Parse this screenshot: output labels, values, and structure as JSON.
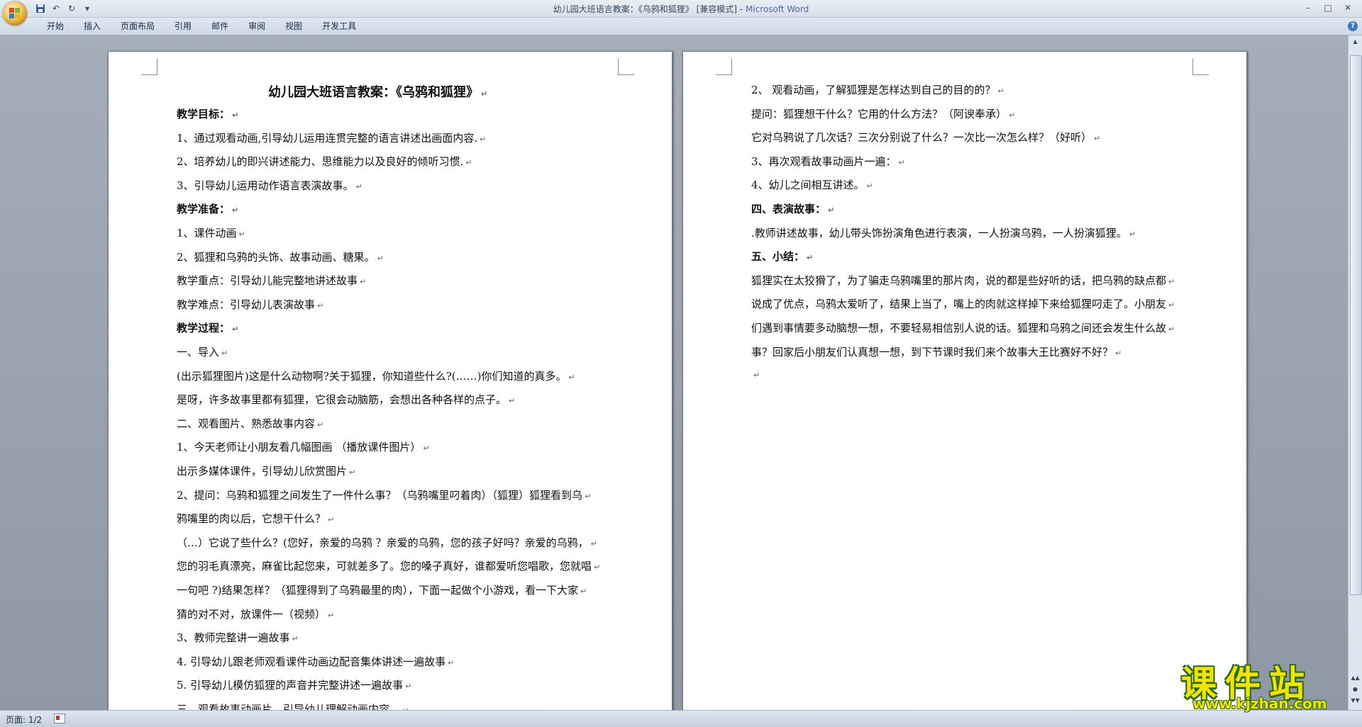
{
  "window": {
    "title_doc": "幼儿园大班语言教案：《乌鸦和狐狸》 [兼容模式]",
    "title_app": "Microsoft Word",
    "minimize": "–",
    "maximize": "□",
    "close": "✕"
  },
  "qat": {
    "save_icon": "floppy-save-icon",
    "undo": "↶",
    "redo": "↻",
    "customize": "▾"
  },
  "ribbon": {
    "tabs": [
      "开始",
      "插入",
      "页面布局",
      "引用",
      "邮件",
      "审阅",
      "视图",
      "开发工具"
    ],
    "help": "?"
  },
  "page1": {
    "title": "幼儿园大班语言教案：《乌鸦和狐狸》",
    "lines": [
      "教学目标：",
      "1、通过观看动画,引导幼儿运用连贯完整的语言讲述出画面内容.",
      " 2、培养幼儿的即兴讲述能力、思维能力以及良好的倾听习惯.",
      "3、引导幼儿运用动作语言表演故事。",
      "教学准备：",
      " 1、课件动画",
      "2、狐狸和乌鸦的头饰、故事动画、糖果。",
      "教学重点：引导幼儿能完整地讲述故事",
      "教学难点：引导幼儿表演故事",
      "教学过程：",
      "    一、导入",
      "   (出示狐狸图片)这是什么动物啊?关于狐狸，你知道些什么?(……)你们知道的真多。",
      "是呀，许多故事里都有狐狸，它很会动脑筋，会想出各种各样的点子。",
      "     二、观看图片、熟悉故事内容",
      "1、今天老师让小朋友看几幅图画 （播放课件图片）",
      "出示多媒体课件，引导幼儿欣赏图片",
      "2、提问：乌鸦和狐狸之间发生了一件什么事？（乌鸦嘴里叼着肉）（狐狸）狐狸看到乌",
      "鸦嘴里的肉以后，它想干什么？",
      "（…）它说了些什么？(您好，亲爱的乌鸦 ？亲爱的乌鸦，您的孩子好吗？亲爱的乌鸦，",
      "您的羽毛真漂亮，麻雀比起您来，可就差多了。您的嗓子真好，谁都爱听您唱歌，您就唱",
      "一句吧 ?)结果怎样？（狐狸得到了乌鸦最里的肉），下面一起做个小游戏，看一下大家",
      "猜的对不对，放课件一（视频）",
      "3、教师完整讲一遍故事",
      "4. 引导幼儿跟老师观看课件动画边配音集体讲述一遍故事",
      "5. 引导幼儿模仿狐狸的声音并完整讲述一遍故事",
      "    三、观看故事动画片、引导幼儿理解动画内容。"
    ]
  },
  "page2": {
    "lines": [
      "2、 观看动画，了解狐狸是怎样达到自己的目的的？",
      "        提问：狐狸想干什么？它用的什么方法？（阿谀奉承）",
      "        它对乌鸦说了几次话？三次分别说了什么？一次比一次怎么样？（好听）",
      "3、再次观看故事动画片一遍：",
      "4、幼儿之间相互讲述。",
      "     四、表演故事：",
      ".教师讲述故事，幼儿带头饰扮演角色进行表演，一人扮演乌鸦，一人扮演狐狸。",
      "     五、小结：",
      "狐狸实在太狡猾了，为了骗走乌鸦嘴里的那片肉，说的都是些好听的话，把乌鸦的缺点都",
      "说成了优点，乌鸦太爱听了，结果上当了，嘴上的肉就这样掉下来给狐狸叼走了。小朋友",
      "们遇到事情要多动脑想一想，不要轻易相信别人说的话。狐狸和乌鸦之间还会发生什么故",
      "事？回家后小朋友们认真想一想，到下节课时我们来个故事大王比赛好不好？",
      ""
    ]
  },
  "status": {
    "page": "页面: 1/2"
  },
  "watermark": {
    "title": "课件站",
    "url": "www.kjzhan.com"
  },
  "colors": {
    "title_app": "#4d6da0",
    "watermark_fill": "#f0e400",
    "watermark_outline": "#2d6a1b"
  }
}
